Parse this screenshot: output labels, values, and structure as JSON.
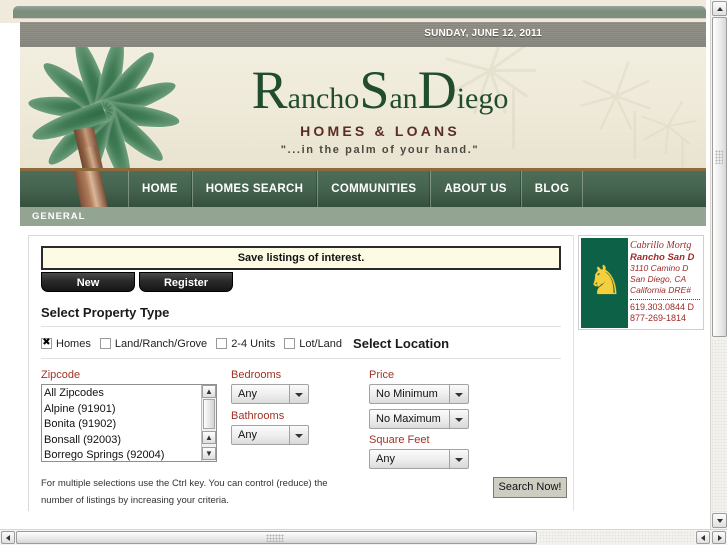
{
  "header": {
    "date": "SUNDAY, JUNE 12, 2011",
    "logo": {
      "word_r": "R",
      "word_ancho": "ancho",
      "word_s": "S",
      "word_an": "an",
      "word_d": "D",
      "word_iego": "iego",
      "subtitle": "HOMES & LOANS",
      "tagline": "\"...in the palm of your hand.\""
    }
  },
  "nav": {
    "items": [
      {
        "label": "HOME"
      },
      {
        "label": "HOMES SEARCH"
      },
      {
        "label": "COMMUNITIES"
      },
      {
        "label": "ABOUT US"
      },
      {
        "label": "BLOG"
      }
    ]
  },
  "breadcrumb": {
    "label": "GENERAL"
  },
  "main": {
    "save_notice": "Save listings of interest.",
    "buttons": {
      "new": "New",
      "register": "Register"
    },
    "property_type_heading": "Select Property Type",
    "location_heading": "Select Location",
    "property_types": [
      {
        "label": "Homes",
        "checked": true
      },
      {
        "label": "Land/Ranch/Grove",
        "checked": false
      },
      {
        "label": "2-4 Units",
        "checked": false
      },
      {
        "label": "Lot/Land",
        "checked": false
      }
    ],
    "zipcode": {
      "label": "Zipcode",
      "options": [
        "All Zipcodes",
        "Alpine (91901)",
        "Bonita (91902)",
        "Bonsall (92003)",
        "Borrego Springs (92004)"
      ]
    },
    "bedrooms": {
      "label": "Bedrooms",
      "value": "Any"
    },
    "bathrooms": {
      "label": "Bathrooms",
      "value": "Any"
    },
    "price": {
      "label": "Price",
      "min_value": "No Minimum",
      "max_value": "No Maximum"
    },
    "square_feet": {
      "label": "Square Feet",
      "value": "Any"
    },
    "help_text": "For multiple selections use the Ctrl key. You can control (reduce) the number of listings by increasing your criteria.",
    "search_button": "Search Now!"
  },
  "sidebar": {
    "ad": {
      "company": "Cabrillo Mortg",
      "branch": "Rancho San D",
      "address1": "3110 Camino D",
      "address2": "San Diego, CA",
      "license": "California DRE#",
      "phone1": "619.303.0844 D",
      "phone2": "877-269-1814",
      "lion_glyph": "♞"
    }
  },
  "colors": {
    "brand_green": "#1f4d2e",
    "nav_green": "#46654f",
    "accent_red": "#9e3224",
    "masthead_bg": "#eee9d8",
    "crumb_bg": "#93a493"
  }
}
